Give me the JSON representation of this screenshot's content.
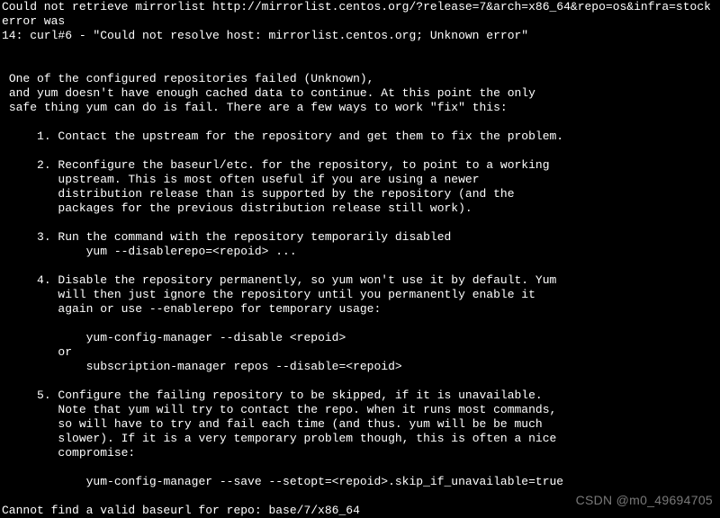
{
  "terminal": {
    "err_line1": "Could not retrieve mirrorlist http://mirrorlist.centos.org/?release=7&arch=x86_64&repo=os&infra=stock error was",
    "err_line2": "14: curl#6 - \"Could not resolve host: mirrorlist.centos.org; Unknown error\"",
    "blank": "",
    "intro1": " One of the configured repositories failed (Unknown),",
    "intro2": " and yum doesn't have enough cached data to continue. At this point the only",
    "intro3": " safe thing yum can do is fail. There are a few ways to work \"fix\" this:",
    "s1_l1": "     1. Contact the upstream for the repository and get them to fix the problem.",
    "s2_l1": "     2. Reconfigure the baseurl/etc. for the repository, to point to a working",
    "s2_l2": "        upstream. This is most often useful if you are using a newer",
    "s2_l3": "        distribution release than is supported by the repository (and the",
    "s2_l4": "        packages for the previous distribution release still work).",
    "s3_l1": "     3. Run the command with the repository temporarily disabled",
    "s3_l2": "            yum --disablerepo=<repoid> ...",
    "s4_l1": "     4. Disable the repository permanently, so yum won't use it by default. Yum",
    "s4_l2": "        will then just ignore the repository until you permanently enable it",
    "s4_l3": "        again or use --enablerepo for temporary usage:",
    "s4_l4": "            yum-config-manager --disable <repoid>",
    "s4_l5": "        or",
    "s4_l6": "            subscription-manager repos --disable=<repoid>",
    "s5_l1": "     5. Configure the failing repository to be skipped, if it is unavailable.",
    "s5_l2": "        Note that yum will try to contact the repo. when it runs most commands,",
    "s5_l3": "        so will have to try and fail each time (and thus. yum will be be much",
    "s5_l4": "        slower). If it is a very temporary problem though, this is often a nice",
    "s5_l5": "        compromise:",
    "s5_l6": "            yum-config-manager --save --setopt=<repoid>.skip_if_unavailable=true",
    "final": "Cannot find a valid baseurl for repo: base/7/x86_64"
  },
  "watermark": "CSDN @m0_49694705"
}
